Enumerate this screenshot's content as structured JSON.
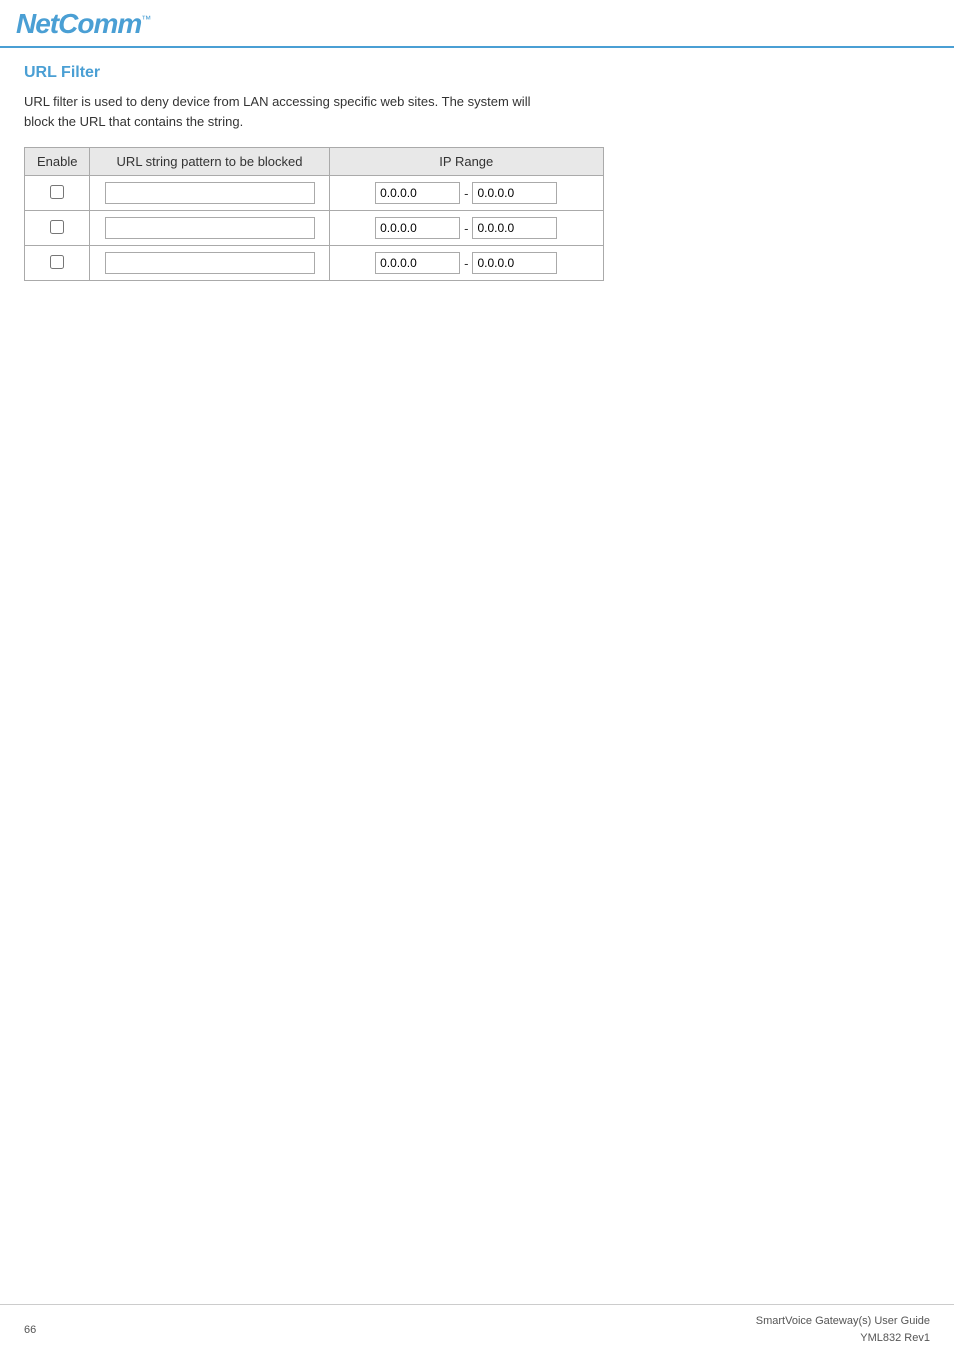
{
  "header": {
    "logo_text": "NetComm",
    "logo_tm": "™"
  },
  "page": {
    "title": "URL Filter",
    "description_line1": "URL filter is used to deny device from LAN accessing specific web sites. The system will",
    "description_line2": "block the URL that contains the string."
  },
  "table": {
    "col_enable": "Enable",
    "col_url": "URL string pattern to be blocked",
    "col_ip_range": "IP Range",
    "rows": [
      {
        "ip_from": "0.0.0.0",
        "ip_to": "0.0.0.0"
      },
      {
        "ip_from": "0.0.0.0",
        "ip_to": "0.0.0.0"
      },
      {
        "ip_from": "0.0.0.0",
        "ip_to": "0.0.0.0"
      }
    ]
  },
  "footer": {
    "page_number": "66",
    "product_line1": "SmartVoice Gateway(s) User Guide",
    "product_line2": "YML832 Rev1"
  }
}
